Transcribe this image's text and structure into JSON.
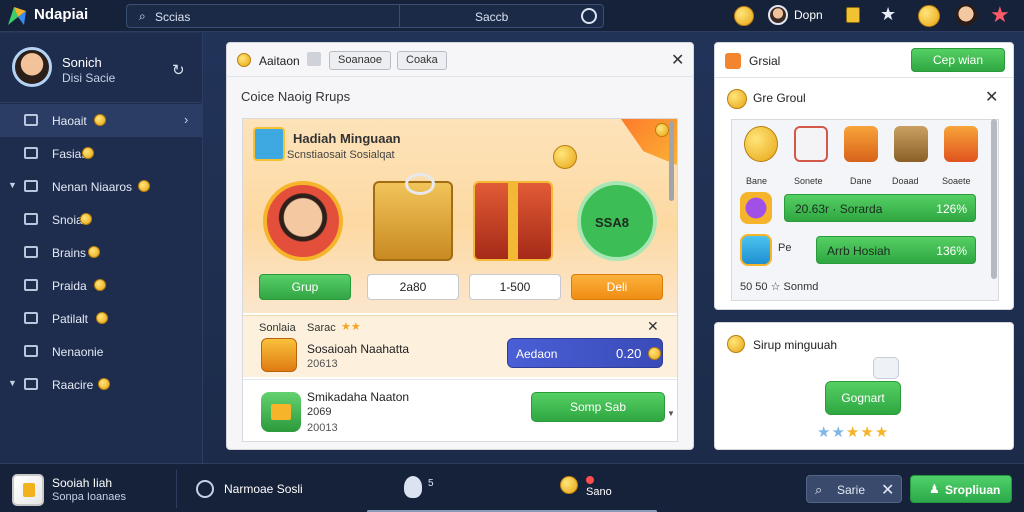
{
  "topbar": {
    "brand": "Ndapiai",
    "search_label": "Sccias",
    "search_value": "Saccb",
    "username": "Dopn",
    "icons": [
      "logo-icon",
      "search-icon",
      "refresh-icon",
      "coin-icon",
      "avatar",
      "badge-icon",
      "star-icon",
      "gold-coin-icon",
      "user-face-icon",
      "red-star-icon"
    ]
  },
  "sidebar": {
    "profile": {
      "name": "Sonich",
      "sub": "Disi Sacie"
    },
    "items": [
      {
        "label": "Haoait",
        "coin": true,
        "chevron": true,
        "active": true,
        "caret": false
      },
      {
        "label": "Fasias",
        "coin": true,
        "chevron": false,
        "active": false,
        "caret": false
      },
      {
        "label": "Nenan Niaaros",
        "coin": true,
        "chevron": false,
        "active": false,
        "caret": true
      },
      {
        "label": "Snoia",
        "coin": true,
        "chevron": false,
        "active": false,
        "caret": false
      },
      {
        "label": "Brains",
        "coin": true,
        "chevron": false,
        "active": false,
        "caret": false
      },
      {
        "label": "Praida",
        "coin": true,
        "chevron": false,
        "active": false,
        "caret": false
      },
      {
        "label": "Patilalt",
        "coin": true,
        "chevron": false,
        "active": false,
        "caret": false
      },
      {
        "label": "Nenaonie",
        "coin": false,
        "chevron": false,
        "active": false,
        "caret": false
      },
      {
        "label": "Raacire",
        "coin": true,
        "chevron": false,
        "active": false,
        "caret": true
      }
    ]
  },
  "main": {
    "header": {
      "title": "Aaitaon",
      "tab1": "Soanaoe",
      "tab2": "Coaka"
    },
    "subtitle": "Coice Naoig Rrups",
    "banner": {
      "title": "Hadiah Minguaan",
      "sub": "Scnstiaosait   Sosialqat",
      "cash_label": "SSA8",
      "buttons": {
        "green": "Grup",
        "white1": "2a80",
        "white2": "1-500",
        "orange": "Deli"
      }
    },
    "row1": {
      "prefix": "Sonlaia",
      "name": "Sarac",
      "title": "Sosaioah Naahatta",
      "sub": "20613",
      "pill_label": "Aedaon",
      "pill_value": "0.20"
    },
    "row2": {
      "title": "Smikadaha Naaton",
      "line2": "2069",
      "line3": "20013",
      "button": "Somp Sab"
    }
  },
  "right_top": {
    "title": "Grsial",
    "button": "Cep wian",
    "subtitle": "Gre Groul",
    "item_labels": [
      "Bane",
      "Sonete",
      "Dane",
      "Doaad",
      "Soaete"
    ],
    "rows": [
      {
        "label": "20.63r · Sorarda",
        "value": "126%"
      },
      {
        "prefix": "Pe",
        "label": "Arrb Hosiah",
        "value": "136%"
      }
    ],
    "last_line": "50 50 ☆ Sonmd"
  },
  "right_bottom": {
    "title": "Sirup minguuah",
    "button": "Gognart"
  },
  "footer": {
    "title": "Sooiah Iiah",
    "sub": "Sonpa Ioanaes",
    "clock_label": "Narmoae Sosli",
    "pin_label": "5",
    "coin_label": "Sano",
    "search_button": "Sarie",
    "primary_button": "Sropliuan"
  },
  "colors": {
    "background": "#1d2c4a",
    "sidebar": "#1e2d4d",
    "green": "#2fa742",
    "orange": "#f08d14",
    "blue_pill": "#3a4bb8",
    "gold": "#e7a514"
  }
}
